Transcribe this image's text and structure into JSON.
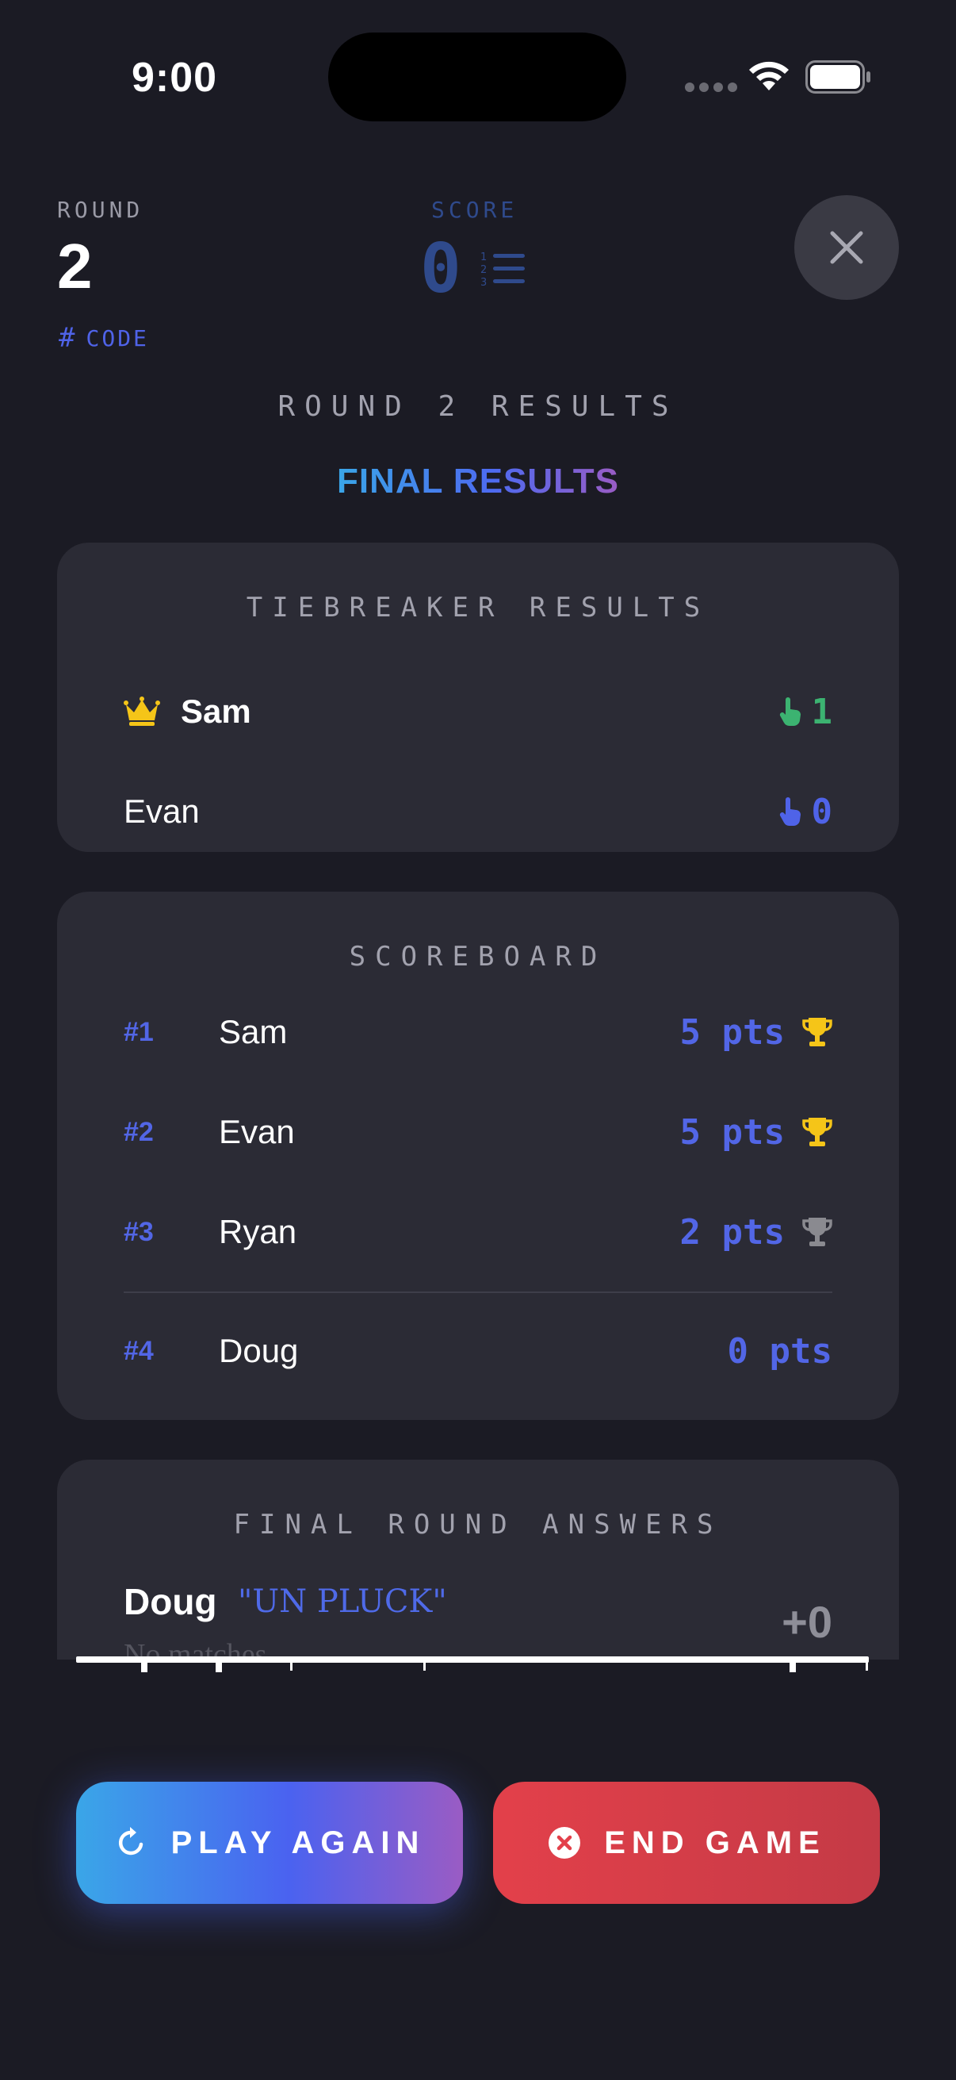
{
  "status_bar": {
    "time": "9:00"
  },
  "header": {
    "round_label": "ROUND",
    "round_value": "2",
    "code_hash": "#",
    "code_label": "CODE",
    "score_label": "SCORE",
    "score_value": "0"
  },
  "round_results_title": "ROUND 2 RESULTS",
  "final_results_title": "FINAL RESULTS",
  "tiebreaker": {
    "title": "TIEBREAKER RESULTS",
    "rows": [
      {
        "name": "Sam",
        "score": "1",
        "winner": true,
        "color": "#3cb371"
      },
      {
        "name": "Evan",
        "score": "0",
        "winner": false,
        "color": "#4f63e8"
      }
    ]
  },
  "scoreboard": {
    "title": "SCOREBOARD",
    "rows": [
      {
        "rank": "#1",
        "name": "Sam",
        "points": "5 pts",
        "trophy": "gold"
      },
      {
        "rank": "#2",
        "name": "Evan",
        "points": "5 pts",
        "trophy": "gold"
      },
      {
        "rank": "#3",
        "name": "Ryan",
        "points": "2 pts",
        "trophy": "silver"
      },
      {
        "rank": "#4",
        "name": "Doug",
        "points": "0 pts",
        "trophy": "none"
      }
    ]
  },
  "final_round_answers": {
    "title": "FINAL ROUND ANSWERS",
    "name": "Doug",
    "answer": "\"UN PLUCK\"",
    "match_text": "No matches",
    "points": "+0"
  },
  "buttons": {
    "play_again": "PLAY AGAIN",
    "end_game": "END GAME"
  },
  "colors": {
    "background": "#1b1b24",
    "card": "#2b2b35",
    "accent_blue": "#5266e6",
    "gold": "#f5c518",
    "silver": "#8a8a90",
    "green": "#3cb371",
    "end_red": "#e3404a"
  },
  "icons": {
    "close": "close-icon",
    "list": "numbered-list-icon",
    "crown": "crown-icon",
    "tap": "tap-hand-icon",
    "trophy": "trophy-icon",
    "refresh": "refresh-icon",
    "cancel": "x-circle-icon"
  }
}
